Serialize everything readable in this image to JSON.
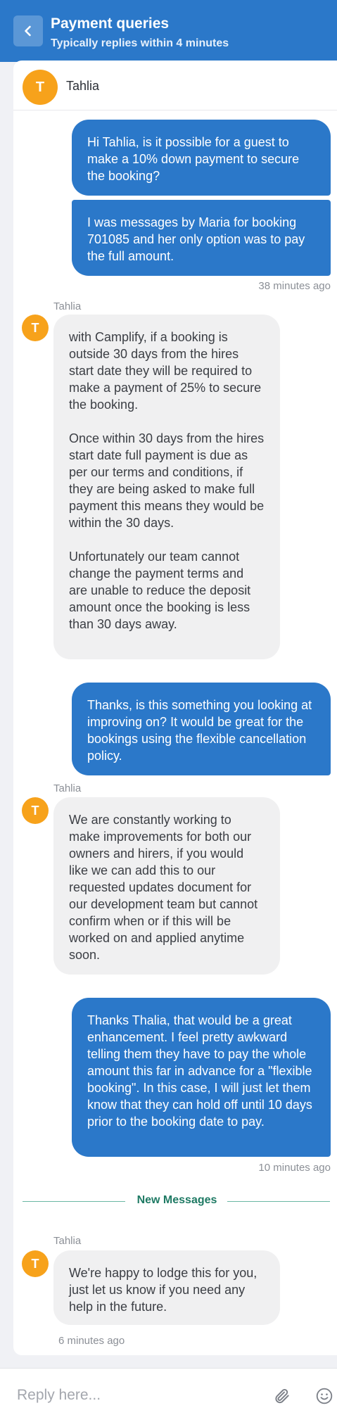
{
  "header": {
    "title": "Payment queries",
    "subtitle": "Typically replies within 4 minutes",
    "back_icon": "chevron-left-icon"
  },
  "agent": {
    "initial": "T",
    "name": "Tahlia"
  },
  "messages": {
    "m1": "Hi Tahlia, is it possible for a guest to make a 10% down payment to secure the booking?",
    "m2": "I was messages by Maria for booking 701085 and her only option was to pay the full amount.",
    "t1": "38 minutes ago",
    "s1": "Tahlia",
    "r1p1": "with Camplify, if a booking is outside 30 days from the hires start date they will be required to make a payment of 25% to secure the booking.",
    "r1p2": "Once within 30 days from the hires start date full payment is due as per our terms and conditions, if they are being asked to make full payment this means they would be within the 30 days.",
    "r1p3": "Unfortunately our team cannot change the payment terms and are unable to reduce the deposit amount once the booking is less than 30 days away.",
    "m3": "Thanks, is this something you looking at improving on? It would be great for the bookings using the flexible cancellation policy.",
    "s2": "Tahlia",
    "r2": "We are constantly working to make improvements for both our owners and hirers, if you would like we can add this to our requested updates document for our development team but cannot confirm when or if this will be worked on and applied anytime soon.",
    "m4": "Thanks Thalia, that would be a great enhancement. I feel pretty awkward telling them they have to pay the whole amount this far in advance for a \"flexible booking\". In this case, I will just let them know that they can hold off until 10 days prior to the booking date to pay.",
    "t2": "10 minutes ago",
    "divider": "New Messages",
    "s3": "Tahlia",
    "r3": "We're happy to lodge this for you, just let us know if you need any help in the future.",
    "t3": "6 minutes ago"
  },
  "composer": {
    "placeholder": "Reply here...",
    "attach_icon": "paperclip-icon",
    "emoji_icon": "emoji-icon"
  },
  "colors": {
    "brand": "#2b78c9",
    "avatar": "#f7a21b",
    "incoming_bubble": "#f0f0f1",
    "divider": "#1f7a64"
  }
}
